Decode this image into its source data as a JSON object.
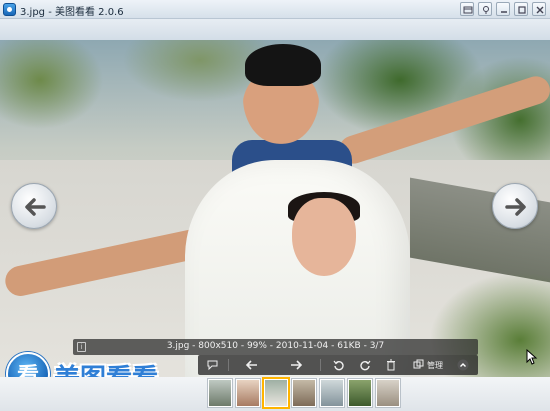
{
  "window": {
    "title": "3.jpg - 美图看看 2.0.6"
  },
  "photo": {
    "alt": ""
  },
  "info": {
    "text": "3.jpg - 800x510 - 99% - 2010-11-04 - 61KB - 3/7"
  },
  "toolbar": {
    "manage_label": "管理"
  },
  "logo": {
    "char": "看",
    "text": "美图看看"
  },
  "icons": {
    "app": "app-icon",
    "prev": "arrow-left-icon",
    "next": "arrow-right-icon",
    "rotate_left": "rotate-left-icon",
    "rotate_right": "rotate-right-icon",
    "delete": "trash-icon",
    "manage": "folder-manage-icon"
  },
  "thumbnails": [
    {
      "label": "thumb-1"
    },
    {
      "label": "thumb-2"
    },
    {
      "label": "thumb-3"
    },
    {
      "label": "thumb-4"
    },
    {
      "label": "thumb-5"
    },
    {
      "label": "thumb-6"
    },
    {
      "label": "thumb-7"
    }
  ],
  "colors": {
    "accent": "#2f7fd6",
    "active_thumb": "#ffb400"
  }
}
